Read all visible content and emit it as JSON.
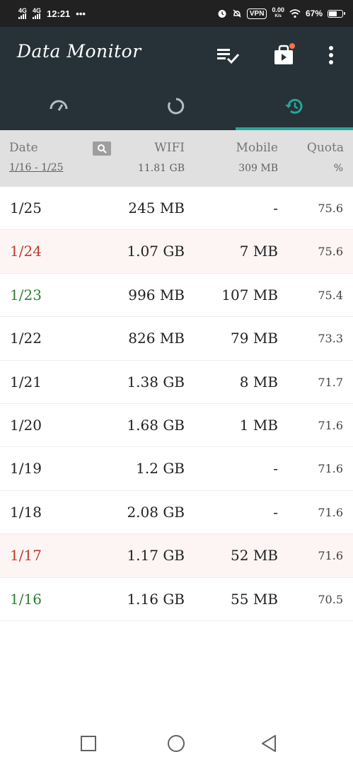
{
  "status_bar": {
    "network_1": "4G",
    "network_2": "4G",
    "time": "12:21",
    "more": "•••",
    "vpn": "VPN",
    "speed_value": "0.00",
    "speed_unit": "K/s",
    "battery": "67%",
    "battery_level": 0.67
  },
  "app_bar": {
    "title": "Data Monitor",
    "icons": [
      "playlist-check-icon",
      "play-store-icon",
      "more-vert-icon"
    ],
    "badge_color": "#ff7043"
  },
  "tabs": [
    {
      "icon": "speedometer-icon",
      "active": false
    },
    {
      "icon": "refresh-circle-icon",
      "active": false
    },
    {
      "icon": "history-icon",
      "active": true
    }
  ],
  "colors": {
    "app_bar": "#263238",
    "accent": "#26a69a",
    "header_bg": "#e0e0e0",
    "red_date": "#c0392b",
    "green_date": "#2e7d32"
  },
  "table": {
    "headers": {
      "date": "Date",
      "date_range": "1/16 - 1/25",
      "wifi": "WIFI",
      "wifi_total": "11.81 GB",
      "mobile": "Mobile",
      "mobile_total": "309 MB",
      "quota": "Quota",
      "quota_unit": "%"
    },
    "rows": [
      {
        "date": "1/25",
        "wifi": "245 MB",
        "mobile": "-",
        "quota": "75.6",
        "style": "normal"
      },
      {
        "date": "1/24",
        "wifi": "1.07 GB",
        "mobile": "7 MB",
        "quota": "75.6",
        "style": "red"
      },
      {
        "date": "1/23",
        "wifi": "996 MB",
        "mobile": "107 MB",
        "quota": "75.4",
        "style": "green"
      },
      {
        "date": "1/22",
        "wifi": "826 MB",
        "mobile": "79 MB",
        "quota": "73.3",
        "style": "normal"
      },
      {
        "date": "1/21",
        "wifi": "1.38 GB",
        "mobile": "8 MB",
        "quota": "71.7",
        "style": "normal"
      },
      {
        "date": "1/20",
        "wifi": "1.68 GB",
        "mobile": "1 MB",
        "quota": "71.6",
        "style": "normal"
      },
      {
        "date": "1/19",
        "wifi": "1.2 GB",
        "mobile": "-",
        "quota": "71.6",
        "style": "normal"
      },
      {
        "date": "1/18",
        "wifi": "2.08 GB",
        "mobile": "-",
        "quota": "71.6",
        "style": "normal"
      },
      {
        "date": "1/17",
        "wifi": "1.17 GB",
        "mobile": "52 MB",
        "quota": "71.6",
        "style": "red"
      },
      {
        "date": "1/16",
        "wifi": "1.16 GB",
        "mobile": "55 MB",
        "quota": "70.5",
        "style": "green"
      }
    ]
  },
  "nav_bar": {
    "icons": [
      "recent-apps-icon",
      "home-icon",
      "back-icon"
    ]
  }
}
